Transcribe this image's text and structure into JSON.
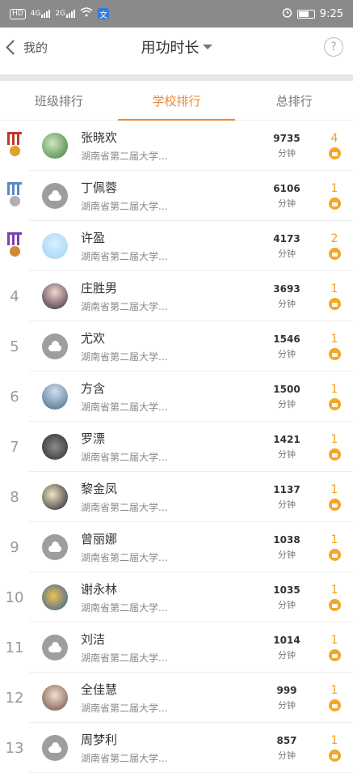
{
  "status": {
    "network": "HD",
    "sig1": "4G",
    "sig2": "2G",
    "app_badge": "文",
    "time": "9:25"
  },
  "header": {
    "back_label": "我的",
    "title": "用功时长",
    "help": "?"
  },
  "tabs": [
    {
      "label": "班级排行",
      "active": false
    },
    {
      "label": "学校排行",
      "active": true
    },
    {
      "label": "总排行",
      "active": false
    }
  ],
  "colors": {
    "accent": "#f08a2d",
    "like": "#f5a623",
    "gold": "#c0392b",
    "silver": "#5b86c5",
    "bronze": "#7b3fb0"
  },
  "rows": [
    {
      "rank": "",
      "medal": "gold",
      "name": "张晓欢",
      "school": "湖南省第二届大学...",
      "minutes": "9735",
      "unit": "分钟",
      "likes": "4",
      "avatar": "photo-green"
    },
    {
      "rank": "",
      "medal": "silver",
      "name": "丁佩蓉",
      "school": "湖南省第二届大学...",
      "minutes": "6106",
      "unit": "分钟",
      "likes": "1",
      "avatar": "default"
    },
    {
      "rank": "",
      "medal": "bronze",
      "name": "许盈",
      "school": "湖南省第二届大学...",
      "minutes": "4173",
      "unit": "分钟",
      "likes": "2",
      "avatar": "photo-blue"
    },
    {
      "rank": "4",
      "name": "庄胜男",
      "school": "湖南省第二届大学...",
      "minutes": "3693",
      "unit": "分钟",
      "likes": "1",
      "avatar": "photo-girl"
    },
    {
      "rank": "5",
      "name": "尤欢",
      "school": "湖南省第二届大学...",
      "minutes": "1546",
      "unit": "分钟",
      "likes": "1",
      "avatar": "default"
    },
    {
      "rank": "6",
      "name": "方含",
      "school": "湖南省第二届大学...",
      "minutes": "1500",
      "unit": "分钟",
      "likes": "1",
      "avatar": "photo-sky"
    },
    {
      "rank": "7",
      "name": "罗漂",
      "school": "湖南省第二届大学...",
      "minutes": "1421",
      "unit": "分钟",
      "likes": "1",
      "avatar": "photo-dark"
    },
    {
      "rank": "8",
      "name": "黎金凤",
      "school": "湖南省第二届大学...",
      "minutes": "1137",
      "unit": "分钟",
      "likes": "1",
      "avatar": "photo-night"
    },
    {
      "rank": "9",
      "name": "曾丽娜",
      "school": "湖南省第二届大学...",
      "minutes": "1038",
      "unit": "分钟",
      "likes": "1",
      "avatar": "default"
    },
    {
      "rank": "10",
      "name": "谢永林",
      "school": "湖南省第二届大学...",
      "minutes": "1035",
      "unit": "分钟",
      "likes": "1",
      "avatar": "photo-cartoon"
    },
    {
      "rank": "11",
      "name": "刘洁",
      "school": "湖南省第二届大学...",
      "minutes": "1014",
      "unit": "分钟",
      "likes": "1",
      "avatar": "default"
    },
    {
      "rank": "12",
      "name": "全佳慧",
      "school": "湖南省第二届大学...",
      "minutes": "999",
      "unit": "分钟",
      "likes": "1",
      "avatar": "photo-face"
    },
    {
      "rank": "13",
      "name": "周梦利",
      "school": "湖南省第二届大学...",
      "minutes": "857",
      "unit": "分钟",
      "likes": "1",
      "avatar": "default"
    }
  ]
}
